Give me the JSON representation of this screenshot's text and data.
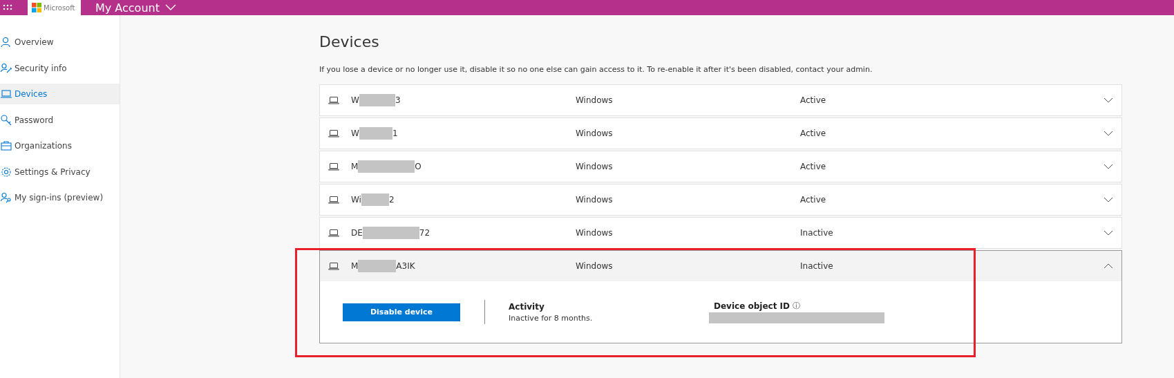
{
  "header": {
    "logo_text": "Microsoft",
    "title": "My Account"
  },
  "sidebar": {
    "items": [
      {
        "label": "Overview",
        "selected": false
      },
      {
        "label": "Security info",
        "selected": false
      },
      {
        "label": "Devices",
        "selected": true
      },
      {
        "label": "Password",
        "selected": false
      },
      {
        "label": "Organizations",
        "selected": false
      },
      {
        "label": "Settings & Privacy",
        "selected": false
      },
      {
        "label": "My sign-ins (preview)",
        "selected": false
      }
    ]
  },
  "main": {
    "title": "Devices",
    "description": "If you lose a device or no longer use it, disable it so no one else can gain access to it. To re-enable it after it's been disabled, contact your admin.",
    "devices": [
      {
        "name_start": "W",
        "name_end": "3",
        "os": "Windows",
        "status": "Active",
        "expanded": false
      },
      {
        "name_start": "W",
        "name_end": "1",
        "os": "Windows",
        "status": "Active",
        "expanded": false
      },
      {
        "name_start": "M",
        "name_end": "O",
        "os": "Windows",
        "status": "Active",
        "expanded": false
      },
      {
        "name_start": "Wi",
        "name_end": "2",
        "os": "Windows",
        "status": "Active",
        "expanded": false
      },
      {
        "name_start": "DE",
        "name_end": "72",
        "os": "Windows",
        "status": "Inactive",
        "expanded": false
      },
      {
        "name_start": "M",
        "name_end": "A3IK",
        "os": "Windows",
        "status": "Inactive",
        "expanded": true,
        "details": {
          "button": "Disable device",
          "activity_label": "Activity",
          "activity_value": "Inactive for 8 months.",
          "id_label": "Device object ID",
          "id_info": "ⓘ"
        }
      }
    ]
  }
}
